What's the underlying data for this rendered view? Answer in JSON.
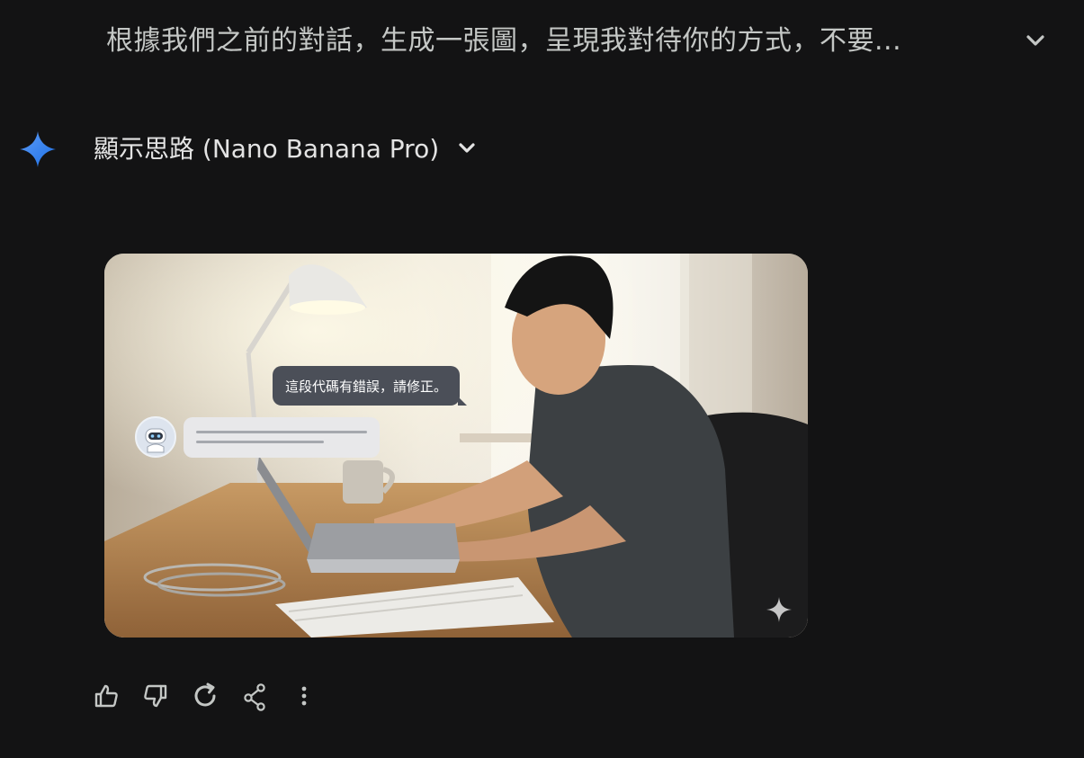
{
  "prompt": {
    "text": "根據我們之前的對話，生成一張圖，呈現我對待你的方式，不要..."
  },
  "thoughts": {
    "label": "顯示思路 (Nano Banana Pro)"
  },
  "image": {
    "user_message": "這段代碼有錯誤，請修正。"
  },
  "icons": {
    "prompt_expand": "chevron-down-icon",
    "assistant": "gemini-spark-icon",
    "thoughts_expand": "chevron-down-icon",
    "watermark": "sparkle-watermark-icon",
    "like": "thumb-up-icon",
    "dislike": "thumb-down-icon",
    "regenerate": "redo-icon",
    "share": "share-icon",
    "more": "more-vertical-icon"
  },
  "colors": {
    "background": "#131314",
    "text_primary": "#e3e3e3",
    "text_secondary": "#c4c7c5",
    "accent_gradient_start": "#4285f4",
    "accent_gradient_end": "#1a73e8"
  }
}
